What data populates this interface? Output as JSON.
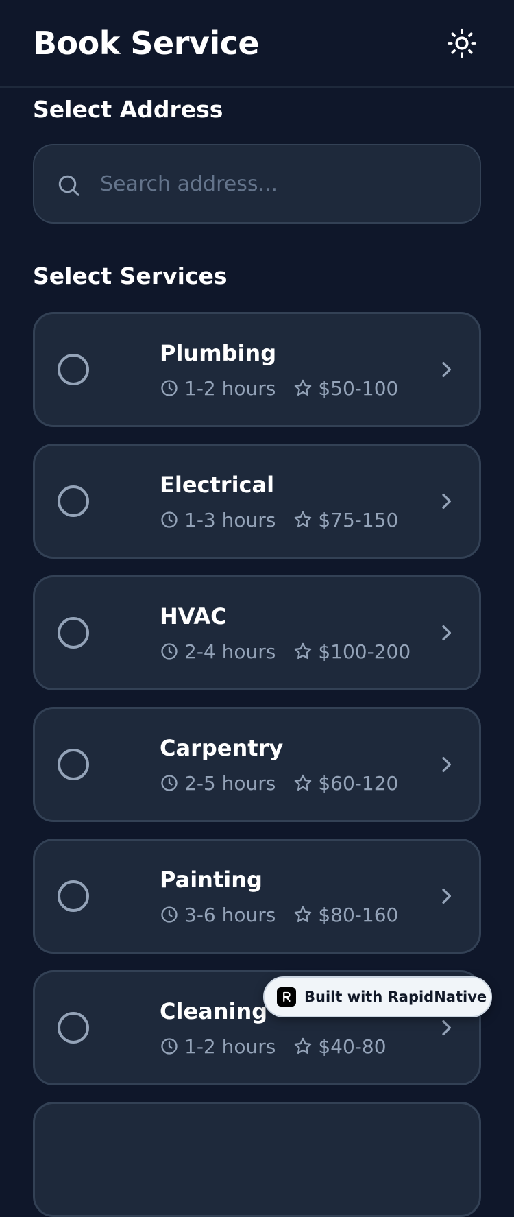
{
  "header": {
    "title": "Book Service",
    "theme_icon": "sun-icon"
  },
  "address": {
    "section_title": "Select Address",
    "search_placeholder": "Search address...",
    "search_value": ""
  },
  "services": {
    "section_title": "Select Services",
    "items": [
      {
        "name": "Plumbing",
        "duration": "1-2 hours",
        "price": "$50-100",
        "selected": false
      },
      {
        "name": "Electrical",
        "duration": "1-3 hours",
        "price": "$75-150",
        "selected": false
      },
      {
        "name": "HVAC",
        "duration": "2-4 hours",
        "price": "$100-200",
        "selected": false
      },
      {
        "name": "Carpentry",
        "duration": "2-5 hours",
        "price": "$60-120",
        "selected": false
      },
      {
        "name": "Painting",
        "duration": "3-6 hours",
        "price": "$80-160",
        "selected": false
      },
      {
        "name": "Cleaning",
        "duration": "1-2 hours",
        "price": "$40-80",
        "selected": false
      }
    ]
  },
  "badge": {
    "label": "Built with RapidNative"
  },
  "colors": {
    "background": "#0f172a",
    "card": "#1e293b",
    "border": "#334155",
    "muted_text": "#94a3b8",
    "placeholder": "#64748b"
  }
}
